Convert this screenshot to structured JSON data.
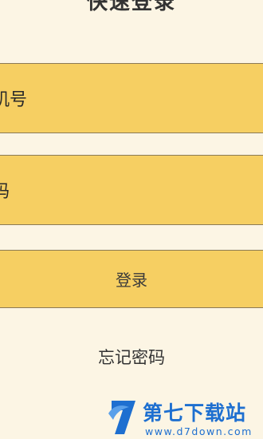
{
  "header": {
    "title": "快速登录"
  },
  "form": {
    "phone_label": "机号",
    "password_label": "码",
    "login_button": "登录",
    "forgot_password": "忘记密码"
  },
  "watermark": {
    "brand": "第七下载站",
    "url": "www.d7down.com"
  },
  "colors": {
    "background": "#fcf5e4",
    "field": "#f6cf62",
    "border": "#8b7a55",
    "watermark": "#1e6fd0"
  }
}
